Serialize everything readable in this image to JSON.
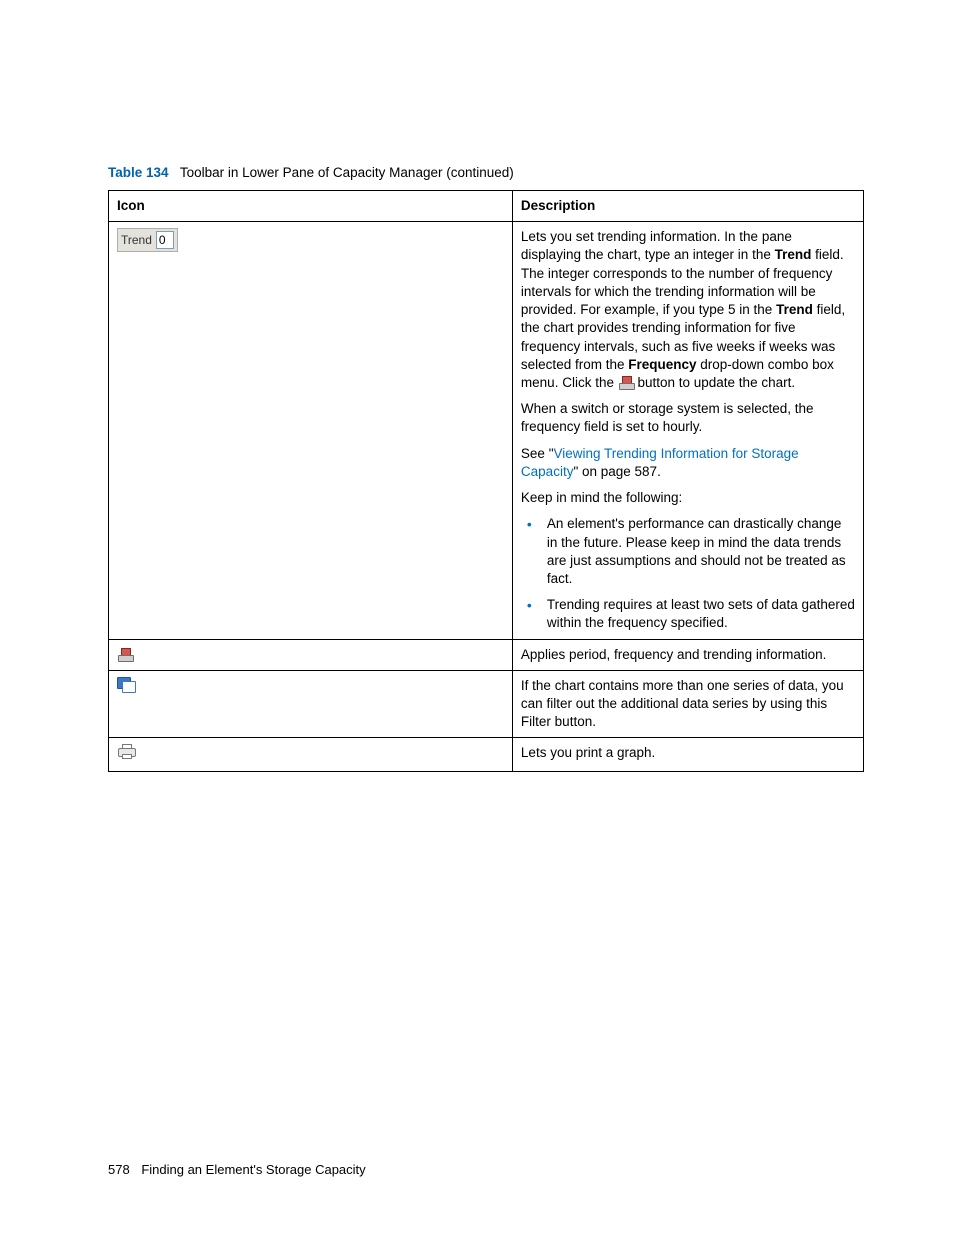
{
  "caption": {
    "label": "Table 134",
    "text": "Toolbar in Lower Pane of Capacity Manager (continued)"
  },
  "headers": {
    "icon": "Icon",
    "description": "Description"
  },
  "row_trend": {
    "widget_label": "Trend",
    "widget_value": "0",
    "p1_pre": "Lets you set trending information. In the pane displaying the chart, type an integer in the ",
    "p1_b1": "Trend",
    "p1_mid": " field. The integer corresponds to the number of frequency intervals for which the trending information will be provided. For example, if you type 5 in the ",
    "p1_b2": "Trend",
    "p1_mid2": " field, the chart provides trending information for five frequency intervals, such as five weeks if weeks was selected from the ",
    "p1_b3": "Frequency",
    "p1_end": " drop-down combo box menu. Click the ",
    "p1_tail": " button to update the chart.",
    "p2": "When a switch or storage system is selected, the frequency field is set to hourly.",
    "p3_pre": "See \"",
    "p3_link": "Viewing Trending Information for Storage Capacity",
    "p3_post": "\" on page 587.",
    "p4": "Keep in mind the following:",
    "bullets": [
      "An element's performance can drastically change in the future. Please keep in mind the data trends are just assumptions and should not be treated as fact.",
      "Trending requires at least two sets of data gathered within the frequency specified."
    ]
  },
  "row_apply": {
    "desc": "Applies period, frequency and trending information."
  },
  "row_filter": {
    "desc": "If the chart contains more than one series of data, you can filter out the additional data series by using this Filter button."
  },
  "row_print": {
    "desc": "Lets you print a graph."
  },
  "footer": {
    "page": "578",
    "section": "Finding an Element's Storage Capacity"
  }
}
